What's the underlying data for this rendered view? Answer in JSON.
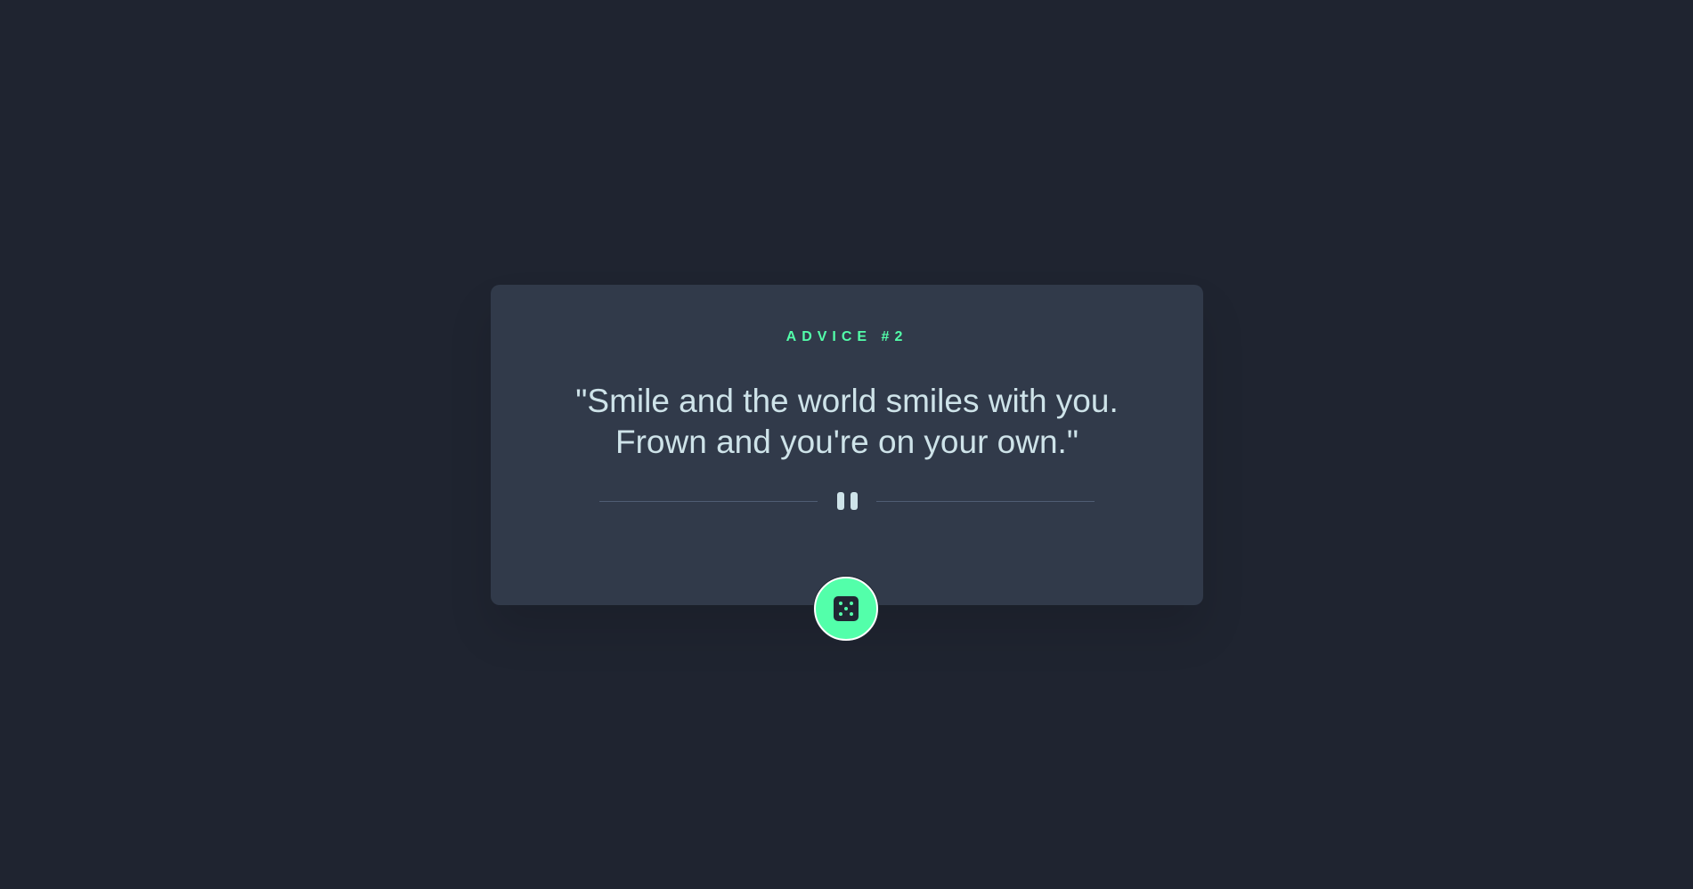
{
  "advice": {
    "label": "ADVICE #2",
    "quote": "\"Smile and the world smiles with you. Frown and you're on your own.\""
  },
  "divider": {
    "icon": "pause-icon"
  },
  "button": {
    "icon": "dice-icon"
  },
  "colors": {
    "background": "#1f2430",
    "card": "#313a4a",
    "accent": "#53ffaa",
    "text": "#cee3e9",
    "divider_line": "#4f5d74"
  }
}
